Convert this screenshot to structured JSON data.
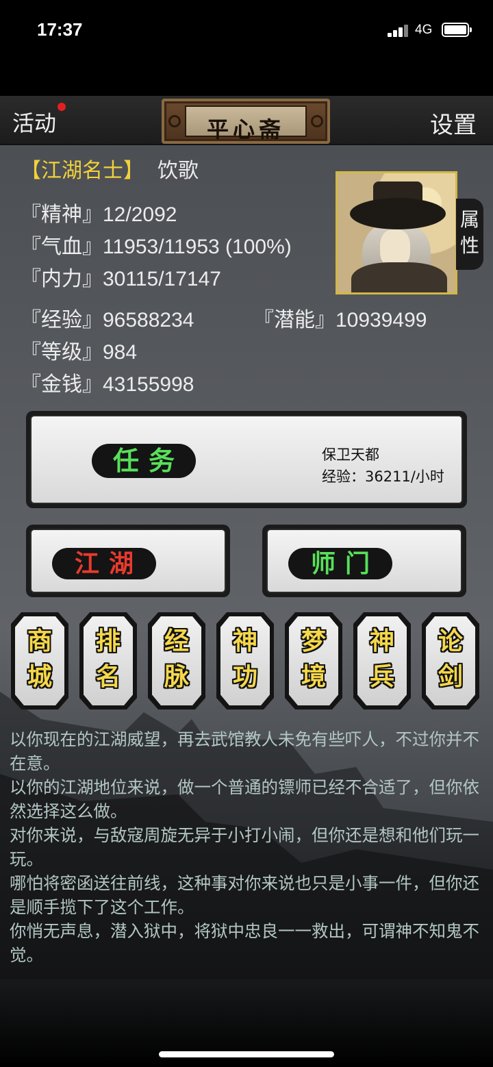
{
  "status": {
    "time": "17:37",
    "network": "4G"
  },
  "topbar": {
    "left": "活动",
    "title": "平心斋",
    "right": "设置"
  },
  "player": {
    "title": "【江湖名士】",
    "name": "饮歌",
    "stats": {
      "spirit": "『精神』12/2092",
      "hp": "『气血』11953/11953 (100%)",
      "mp": "『内力』30115/17147",
      "exp": "『经验』96588234",
      "potential": "『潜能』10939499",
      "level": "『等级』984",
      "money": "『金钱』43155998"
    },
    "side_tab": [
      "属",
      "性"
    ]
  },
  "mission": {
    "label": "任务",
    "name": "保卫天都",
    "rate": "经验：36211/小时"
  },
  "buttons": {
    "jianghu": "江湖",
    "shimen": "师门"
  },
  "tokens": [
    [
      "商",
      "城"
    ],
    [
      "排",
      "名"
    ],
    [
      "经",
      "脉"
    ],
    [
      "神",
      "功"
    ],
    [
      "梦",
      "境"
    ],
    [
      "神",
      "兵"
    ],
    [
      "论",
      "剑"
    ]
  ],
  "log": [
    "以你现在的江湖威望，再去武馆教人未免有些吓人，不过你并不在意。",
    "以你的江湖地位来说，做一个普通的镖师已经不合适了，但你依然选择这么做。",
    "对你来说，与敌寇周旋无异于小打小闹，但你还是想和他们玩一玩。",
    "哪怕将密函送往前线，这种事对你来说也只是小事一件，但你还是顺手揽下了这个工作。",
    "你悄无声息，潜入狱中，将狱中忠良一一救出，可谓神不知鬼不觉。"
  ]
}
